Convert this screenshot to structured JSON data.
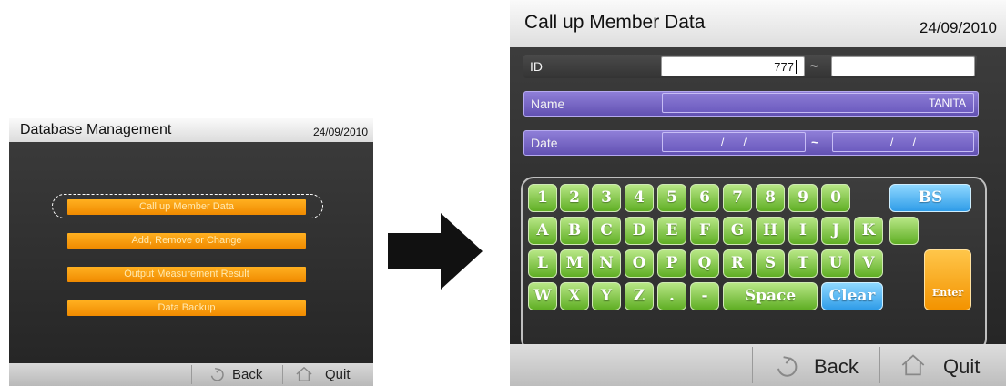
{
  "small_screen": {
    "title": "Database Management",
    "date": "24/09/2010",
    "menu": [
      {
        "label": "Call up Member Data"
      },
      {
        "label": "Add, Remove or Change"
      },
      {
        "label": "Output Measurement Result"
      },
      {
        "label": "Data Backup"
      }
    ],
    "footer": {
      "back_label": "Back",
      "quit_label": "Quit"
    }
  },
  "big_screen": {
    "title": "Call up Member Data",
    "date": "24/09/2010",
    "id_row": {
      "label": "ID",
      "from_value": "777",
      "separator": "~",
      "to_value": ""
    },
    "name_row": {
      "label": "Name",
      "value": "TANITA"
    },
    "date_row": {
      "label": "Date",
      "from_value": "/ /",
      "separator": "~",
      "to_value": "/ /"
    },
    "keyboard": {
      "row1": [
        "1",
        "2",
        "3",
        "4",
        "5",
        "6",
        "7",
        "8",
        "9",
        "0"
      ],
      "row2": [
        "A",
        "B",
        "C",
        "D",
        "E",
        "F",
        "G",
        "H",
        "I",
        "J",
        "K"
      ],
      "row3": [
        "L",
        "M",
        "N",
        "O",
        "P",
        "Q",
        "R",
        "S",
        "T",
        "U",
        "V"
      ],
      "row4": [
        "W",
        "X",
        "Y",
        "Z",
        ".",
        "-"
      ],
      "bs_label": "BS",
      "space_label": "Space",
      "clear_label": "Clear",
      "enter_label": "Enter"
    },
    "footer": {
      "back_label": "Back",
      "quit_label": "Quit"
    }
  },
  "colors": {
    "menu_orange": "#f5a000",
    "key_green": "#7cc63f",
    "key_blue": "#3aa8f0",
    "row_purple": "#7a68c8"
  },
  "icons": {
    "back": "back-arrow-icon",
    "quit": "home-icon",
    "transition": "right-arrow-icon"
  }
}
